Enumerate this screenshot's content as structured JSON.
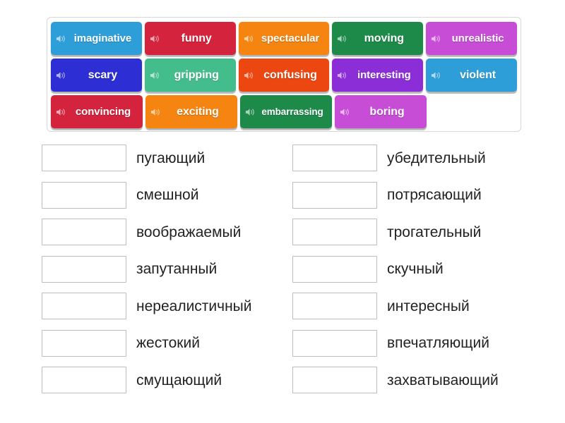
{
  "activity": {
    "type": "match-up",
    "icon_name": "speaker-icon"
  },
  "wordbank": {
    "rows": [
      [
        {
          "label": "imaginative",
          "color": "#2e9ed8",
          "size": "med"
        },
        {
          "label": "funny",
          "color": "#d4233c",
          "size": "normal"
        },
        {
          "label": "spectacular",
          "color": "#f58410",
          "size": "med"
        },
        {
          "label": "moving",
          "color": "#1e8a4a",
          "size": "normal"
        },
        {
          "label": "unrealistic",
          "color": "#c84dd6",
          "size": "med"
        }
      ],
      [
        {
          "label": "scary",
          "color": "#2d2fd4",
          "size": "normal"
        },
        {
          "label": "gripping",
          "color": "#44bd8c",
          "size": "normal"
        },
        {
          "label": "confusing",
          "color": "#ec4711",
          "size": "normal"
        },
        {
          "label": "interesting",
          "color": "#8c2ed8",
          "size": "med"
        },
        {
          "label": "violent",
          "color": "#2e9ed8",
          "size": "normal"
        }
      ],
      [
        {
          "label": "convincing",
          "color": "#d4233c",
          "size": "med"
        },
        {
          "label": "exciting",
          "color": "#f58410",
          "size": "normal"
        },
        {
          "label": "embarrassing",
          "color": "#1e8a4a",
          "size": "small"
        },
        {
          "label": "boring",
          "color": "#c84dd6",
          "size": "normal"
        }
      ]
    ]
  },
  "answers": {
    "left_column": [
      {
        "placeholder_slot": "",
        "text": "пугающий"
      },
      {
        "placeholder_slot": "",
        "text": "смешной"
      },
      {
        "placeholder_slot": "",
        "text": "воображаемый"
      },
      {
        "placeholder_slot": "",
        "text": "запутанный"
      },
      {
        "placeholder_slot": "",
        "text": "нереалистичный"
      },
      {
        "placeholder_slot": "",
        "text": "жестокий"
      },
      {
        "placeholder_slot": "",
        "text": "смущающий"
      }
    ],
    "right_column": [
      {
        "placeholder_slot": "",
        "text": "убедительный"
      },
      {
        "placeholder_slot": "",
        "text": "потрясающий"
      },
      {
        "placeholder_slot": "",
        "text": "трогательный"
      },
      {
        "placeholder_slot": "",
        "text": "скучный"
      },
      {
        "placeholder_slot": "",
        "text": "интересный"
      },
      {
        "placeholder_slot": "",
        "text": "впечатляющий"
      },
      {
        "placeholder_slot": "",
        "text": "захватывающий"
      }
    ]
  }
}
